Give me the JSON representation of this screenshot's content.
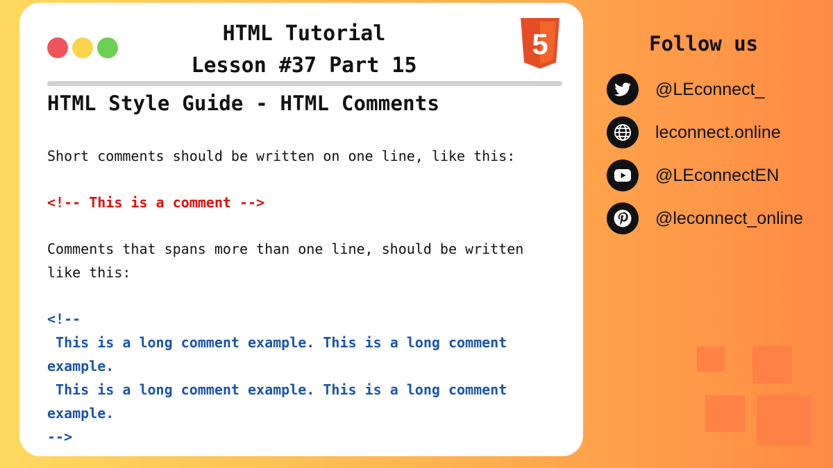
{
  "header": {
    "title_line1": "HTML Tutorial",
    "title_line2": "Lesson #37 Part 15",
    "window_dots": [
      "#f2545b",
      "#f7d44c",
      "#6cd053"
    ],
    "logo_icon": "html5-logo-icon",
    "logo_text": "5"
  },
  "lesson": {
    "heading": "HTML Style Guide - HTML Comments",
    "para1": "Short comments should be written on one line, like this:",
    "short_comment": "<!-- This is a comment -->",
    "para2": "Comments that spans more than one line, should be written like this:",
    "long_comment": [
      "<!--",
      " This is a long comment example. This is a long comment example.",
      " This is a long comment example. This is a long comment example.",
      "-->"
    ]
  },
  "sidebar": {
    "follow_title": "Follow us",
    "links": [
      {
        "icon": "twitter-icon",
        "label": "@LEconnect_"
      },
      {
        "icon": "globe-icon",
        "label": "leconnect.online"
      },
      {
        "icon": "youtube-icon",
        "label": "@LEconnectEN"
      },
      {
        "icon": "pinterest-icon",
        "label": "@leconnect_online"
      }
    ]
  },
  "colors": {
    "comment_red": "#e00d0d",
    "comment_blue": "#1a55a6",
    "html5_orange": "#e44d26"
  }
}
